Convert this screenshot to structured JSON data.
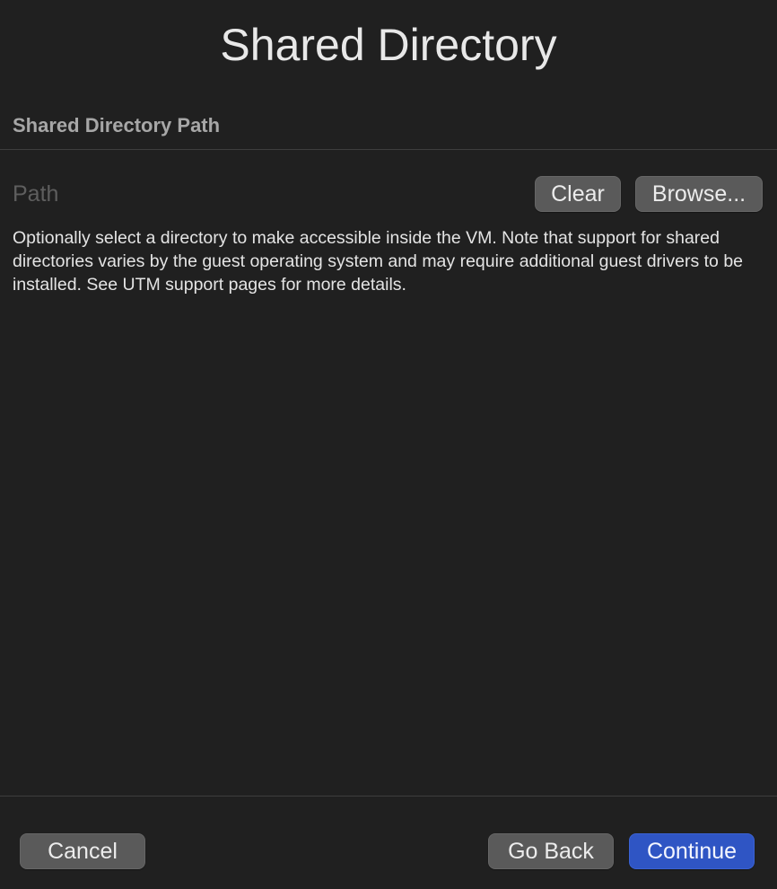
{
  "window": {
    "title": "Shared Directory"
  },
  "section": {
    "label": "Shared Directory Path"
  },
  "path_field": {
    "value": "",
    "placeholder": "Path"
  },
  "buttons": {
    "clear_label": "Clear",
    "browse_label": "Browse..."
  },
  "help_text": "Optionally select a directory to make accessible inside the VM. Note that support for shared directories varies by the guest operating system and may require additional guest drivers to be installed. See UTM support pages for more details.",
  "footer": {
    "cancel_label": "Cancel",
    "go_back_label": "Go Back",
    "continue_label": "Continue"
  },
  "colors": {
    "background": "#202020",
    "button": "#5a5a5a",
    "accent": "#2f55c4"
  }
}
